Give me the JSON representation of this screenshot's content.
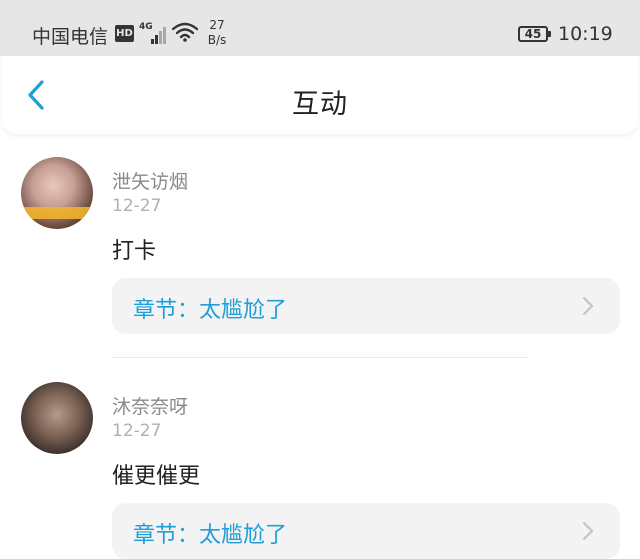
{
  "status_bar": {
    "carrier": "中国电信",
    "hd_badge": "HD",
    "network_tag": "4G",
    "speed_value": "27",
    "speed_unit": "B/s",
    "battery": "45",
    "time": "10:19"
  },
  "nav": {
    "title": "互动",
    "back_icon": "chevron-left-icon"
  },
  "comments": [
    {
      "username": "泄矢访烟",
      "date": "12-27",
      "content": "打卡",
      "chapter_label": "章节：太尴尬了"
    },
    {
      "username": "沐奈奈呀",
      "date": "12-27",
      "content": "催更催更",
      "chapter_label": "章节：太尴尬了"
    }
  ],
  "colors": {
    "accent": "#1f9fd9",
    "status_bar_bg": "#e6e6e6",
    "card_bg": "#f3f3f3"
  }
}
